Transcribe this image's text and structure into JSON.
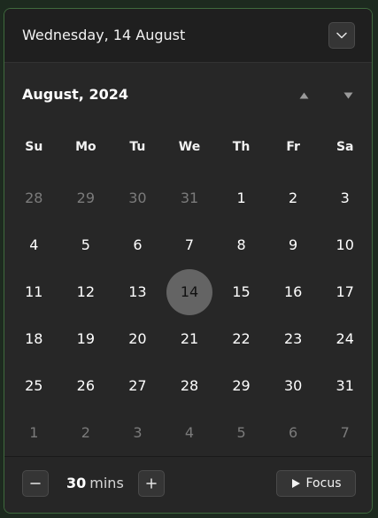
{
  "header": {
    "date_label": "Wednesday, 14 August",
    "collapse_icon": "chevron-down-icon"
  },
  "calendar": {
    "month_title": "August, 2024",
    "prev_icon": "triangle-up-icon",
    "next_icon": "triangle-down-icon",
    "weekdays": [
      "Su",
      "Mo",
      "Tu",
      "We",
      "Th",
      "Fr",
      "Sa"
    ],
    "days": [
      {
        "label": "28",
        "current_month": false
      },
      {
        "label": "29",
        "current_month": false
      },
      {
        "label": "30",
        "current_month": false
      },
      {
        "label": "31",
        "current_month": false
      },
      {
        "label": "1",
        "current_month": true
      },
      {
        "label": "2",
        "current_month": true
      },
      {
        "label": "3",
        "current_month": true
      },
      {
        "label": "4",
        "current_month": true
      },
      {
        "label": "5",
        "current_month": true
      },
      {
        "label": "6",
        "current_month": true
      },
      {
        "label": "7",
        "current_month": true
      },
      {
        "label": "8",
        "current_month": true
      },
      {
        "label": "9",
        "current_month": true
      },
      {
        "label": "10",
        "current_month": true
      },
      {
        "label": "11",
        "current_month": true
      },
      {
        "label": "12",
        "current_month": true
      },
      {
        "label": "13",
        "current_month": true
      },
      {
        "label": "14",
        "current_month": true,
        "today": true
      },
      {
        "label": "15",
        "current_month": true
      },
      {
        "label": "16",
        "current_month": true
      },
      {
        "label": "17",
        "current_month": true
      },
      {
        "label": "18",
        "current_month": true
      },
      {
        "label": "19",
        "current_month": true
      },
      {
        "label": "20",
        "current_month": true
      },
      {
        "label": "21",
        "current_month": true
      },
      {
        "label": "22",
        "current_month": true
      },
      {
        "label": "23",
        "current_month": true
      },
      {
        "label": "24",
        "current_month": true
      },
      {
        "label": "25",
        "current_month": true
      },
      {
        "label": "26",
        "current_month": true
      },
      {
        "label": "27",
        "current_month": true
      },
      {
        "label": "28",
        "current_month": true
      },
      {
        "label": "29",
        "current_month": true
      },
      {
        "label": "30",
        "current_month": true
      },
      {
        "label": "31",
        "current_month": true
      },
      {
        "label": "1",
        "current_month": false
      },
      {
        "label": "2",
        "current_month": false
      },
      {
        "label": "3",
        "current_month": false
      },
      {
        "label": "4",
        "current_month": false
      },
      {
        "label": "5",
        "current_month": false
      },
      {
        "label": "6",
        "current_month": false
      },
      {
        "label": "7",
        "current_month": false
      }
    ]
  },
  "focus": {
    "duration_value": "30",
    "duration_unit": "mins",
    "minus_icon": "minus-icon",
    "plus_icon": "plus-icon",
    "focus_label": "Focus",
    "focus_icon": "play-icon"
  },
  "colors": {
    "panel_background": "#272727",
    "header_background": "#1f1f1f",
    "today_highlight": "#646464",
    "outside_month_text": "#7b7b7b",
    "window_border_accent": "#3f6a3d"
  }
}
